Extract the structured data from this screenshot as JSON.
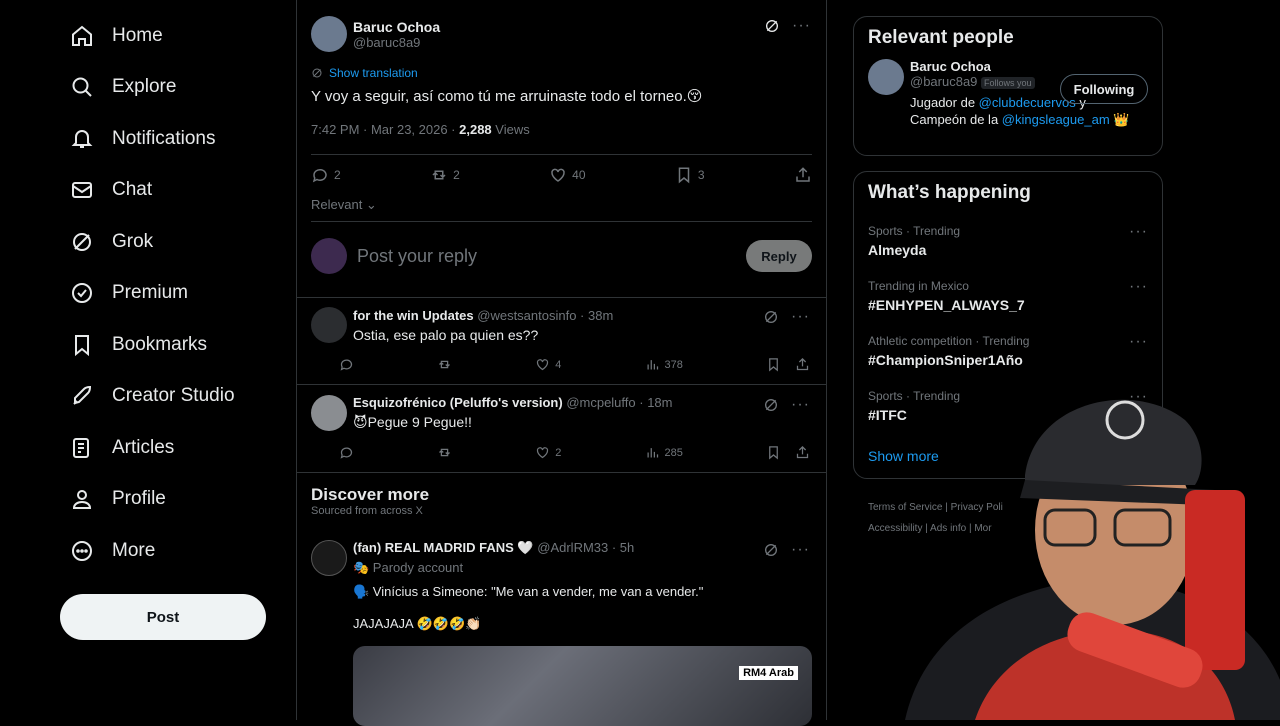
{
  "nav": {
    "items": [
      {
        "label": "Home",
        "icon": "home-icon"
      },
      {
        "label": "Explore",
        "icon": "search-icon"
      },
      {
        "label": "Notifications",
        "icon": "bell-icon"
      },
      {
        "label": "Chat",
        "icon": "mail-icon"
      },
      {
        "label": "Grok",
        "icon": "grok-icon"
      },
      {
        "label": "Premium",
        "icon": "verified-icon"
      },
      {
        "label": "Bookmarks",
        "icon": "bookmark-icon"
      },
      {
        "label": "Creator Studio",
        "icon": "rocket-icon"
      },
      {
        "label": "Articles",
        "icon": "article-icon"
      },
      {
        "label": "Profile",
        "icon": "person-icon"
      },
      {
        "label": "More",
        "icon": "more-circle-icon"
      }
    ],
    "post_label": "Post"
  },
  "focus_tweet": {
    "name": "Baruc Ochoa",
    "handle": "@baruc8a9",
    "translate": "Show translation",
    "text": "Y voy a seguir, así como tú me arruinaste todo el torneo.😚",
    "time": "7:42 PM · Mar 23, 2026 · ",
    "views_count": "2,288",
    "views_label": " Views",
    "replies": "2",
    "reposts": "2",
    "likes": "40",
    "bookmarks": "3"
  },
  "sort_label": "Relevant",
  "reply_box": {
    "placeholder": "Post your reply",
    "button": "Reply"
  },
  "replies": [
    {
      "name": "for the win Updates",
      "handle": "@westsantosinfo · 38m",
      "text": "Ostia, ese palo pa quien es??",
      "likes": "4",
      "views": "378"
    },
    {
      "name": "Esquizofrénico (Peluffo's version)",
      "handle": "@mcpeluffo · 18m",
      "text": "😈Pegue 9 Pegue!!",
      "likes": "2",
      "views": "285"
    }
  ],
  "discover": {
    "title": "Discover more",
    "subtitle": "Sourced from across X",
    "tweet": {
      "name": "(fan) REAL MADRID FANS 🤍",
      "handle": "@AdrlRM33 · 5h",
      "parody": "🎭 Parody account",
      "line1": "🗣️ Vinícius a Simeone: \"Me van a vender, me van a vender.\"",
      "line2": "JAJAJAJA 🤣🤣🤣👏🏻",
      "badge": "RM4 Arab"
    }
  },
  "relevant_people": {
    "title": "Relevant people",
    "name": "Baruc Ochoa",
    "handle": "@baruc8a9",
    "follows_you": "Follows you",
    "follow_button": "Following",
    "bio_1": "Jugador de ",
    "bio_link1": "@clubdecuervos",
    "bio_2": " y",
    "bio_3": "Campeón de la ",
    "bio_link2": "@kingsleague_am",
    "bio_4": " 👑"
  },
  "happening": {
    "title": "What’s happening",
    "trends": [
      {
        "category": "Sports · Trending",
        "title": "Almeyda"
      },
      {
        "category": "Trending in Mexico",
        "title": "#ENHYPEN_ALWAYS_7"
      },
      {
        "category": "Athletic competition · Trending",
        "title": "#ChampionSniper1Año"
      },
      {
        "category": "Sports · Trending",
        "title": "#ITFC"
      }
    ],
    "show_more": "Show more"
  },
  "footer": {
    "line1": "Terms of Service  |  Privacy Poli",
    "line2": "Accessibility  |  Ads info  |  Mor"
  }
}
